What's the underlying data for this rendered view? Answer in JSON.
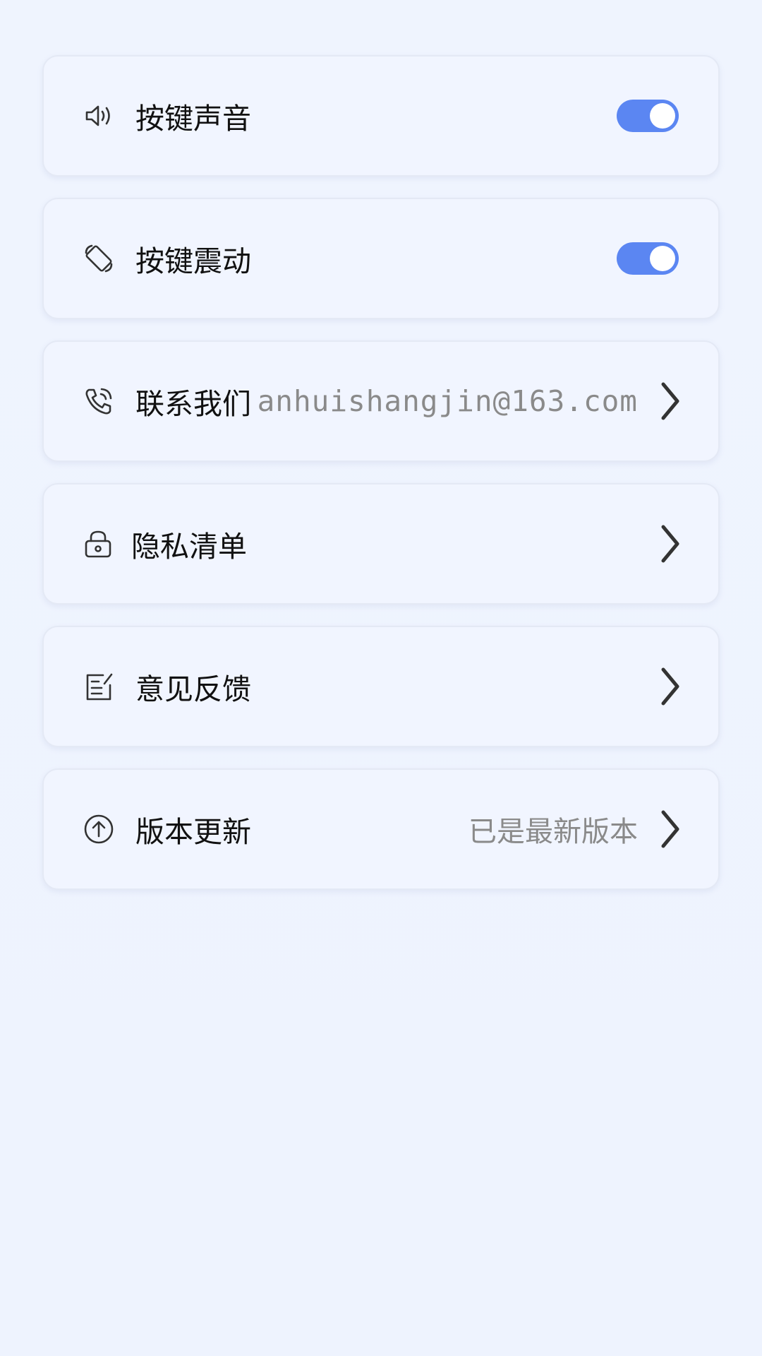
{
  "settings": {
    "items": [
      {
        "label": "按键声音",
        "icon": "speaker-icon",
        "control": "toggle",
        "on": true
      },
      {
        "label": "按键震动",
        "icon": "vibrate-icon",
        "control": "toggle",
        "on": true
      },
      {
        "label": "联系我们",
        "icon": "phone-icon",
        "value": "anhuishangjin@163.com",
        "control": "chevron"
      },
      {
        "label": "隐私清单",
        "icon": "lock-icon",
        "control": "chevron"
      },
      {
        "label": "意见反馈",
        "icon": "edit-icon",
        "control": "chevron"
      },
      {
        "label": "版本更新",
        "icon": "upload-circle-icon",
        "value": "已是最新版本",
        "control": "chevron"
      }
    ]
  },
  "colors": {
    "accent": "#5b86f2",
    "background": "#eff4fe",
    "card": "#f1f5ff",
    "text": "#111111",
    "secondary_text": "#8a8a8a"
  }
}
